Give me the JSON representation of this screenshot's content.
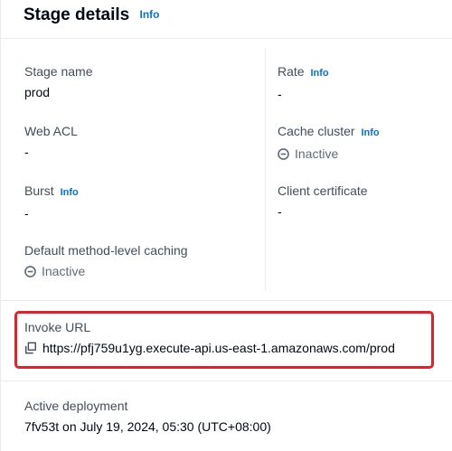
{
  "section": {
    "title": "Stage details",
    "info": "Info"
  },
  "fields": {
    "stage_name": {
      "label": "Stage name",
      "value": "prod"
    },
    "rate": {
      "label": "Rate",
      "info": "Info",
      "value": "-"
    },
    "web_acl": {
      "label": "Web ACL",
      "value": "-"
    },
    "cache_cluster": {
      "label": "Cache cluster",
      "info": "Info",
      "value": "Inactive"
    },
    "burst": {
      "label": "Burst",
      "info": "Info",
      "value": "-"
    },
    "client_certificate": {
      "label": "Client certificate",
      "value": "-"
    },
    "default_caching": {
      "label": "Default method-level caching",
      "value": "Inactive"
    }
  },
  "invoke": {
    "label": "Invoke URL",
    "url": "https://pfj759u1yg.execute-api.us-east-1.amazonaws.com/prod"
  },
  "deployment": {
    "label": "Active deployment",
    "value": "7fv53t on July 19, 2024, 05:30 (UTC+08:00)"
  },
  "colors": {
    "link": "#0972d3",
    "highlight": "#e4202a",
    "label": "#414d5c",
    "inactive": "#5f6b7a"
  },
  "icons": {
    "status": "minus-circle-icon",
    "copy": "copy-icon"
  }
}
